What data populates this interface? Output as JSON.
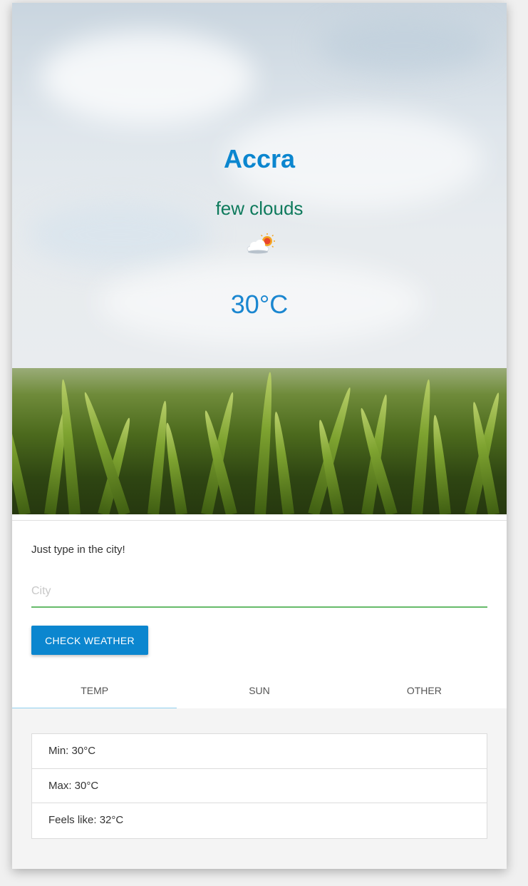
{
  "weather": {
    "city": "Accra",
    "description": "few clouds",
    "icon": "few-clouds-icon",
    "temperature": "30°C"
  },
  "form": {
    "hint": "Just type in the city!",
    "city_placeholder": "City",
    "city_value": "",
    "button_label": "CHECK WEATHER"
  },
  "tabs": [
    {
      "label": "TEMP",
      "active": true
    },
    {
      "label": "SUN",
      "active": false
    },
    {
      "label": "OTHER",
      "active": false
    }
  ],
  "temp_panel": {
    "items": [
      {
        "label": "Min: 30°C"
      },
      {
        "label": "Max: 30°C"
      },
      {
        "label": "Feels like: 32°C"
      }
    ]
  },
  "colors": {
    "accent": "#0b86cf",
    "description": "#0e7a5c",
    "input_underline": "#66bb6a",
    "active_tab": "#8fd0ee"
  }
}
